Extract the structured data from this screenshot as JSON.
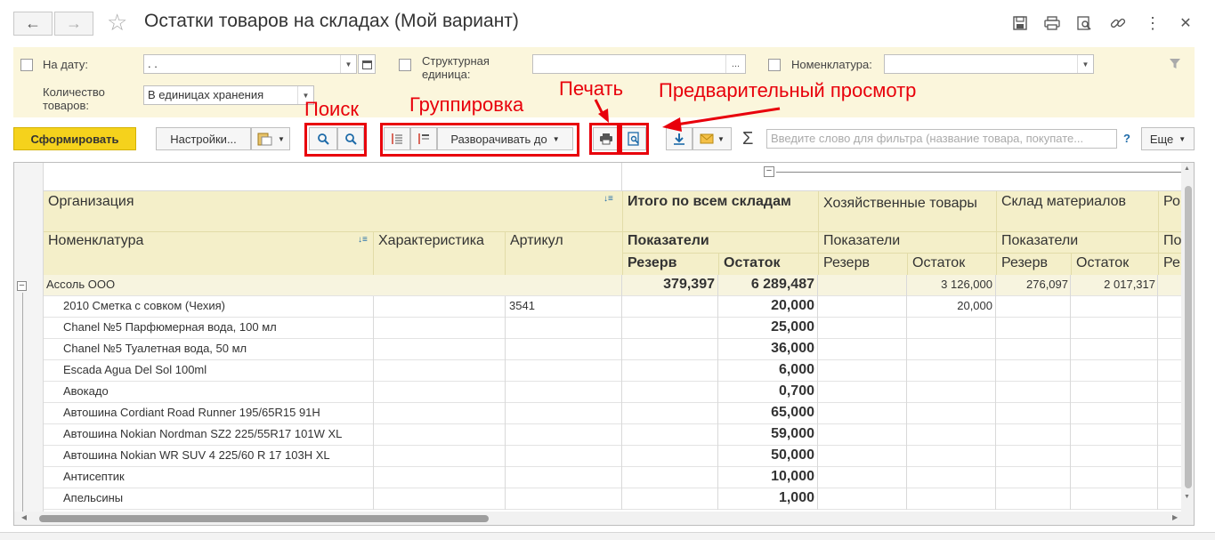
{
  "window": {
    "title": "Остатки товаров на складах (Мой вариант)",
    "back_icon": "←",
    "forward_icon": "→",
    "star_icon": "☆"
  },
  "filters": {
    "date_label": "На дату:",
    "date_value": " .  .",
    "structural_label": "Структурная единица:",
    "structural_value": "",
    "structural_button": "...",
    "nomenclature_label": "Номенклатура:",
    "nomenclature_value": "",
    "quantity_label": "Количество товаров:",
    "quantity_value": "В единицах хранения"
  },
  "toolbar": {
    "generate_label": "Сформировать",
    "settings_label": "Настройки...",
    "expand_label": "Разворачивать до",
    "filter_placeholder": "Введите слово для фильтра (название товара, покупате...",
    "help_label": "?",
    "more_label": "Еще",
    "sigma_label": "Σ"
  },
  "annotations": {
    "search": "Поиск",
    "grouping": "Группировка",
    "print": "Печать",
    "preview": "Предварительный просмотр"
  },
  "table": {
    "header": {
      "organization": "Организация",
      "nomenclature": "Номенклатура",
      "characteristic": "Характеристика",
      "article": "Артикул",
      "total": "Итого по всем складам",
      "warehouse1": "Хозяйственные товары",
      "warehouse2": "Склад материалов",
      "warehouse3": "Ро",
      "indicators": "Показатели",
      "indicators_cut": "По",
      "reserve": "Резерв",
      "remainder": "Остаток",
      "reserve_cut": "Ре"
    },
    "group_row": {
      "name": "Ассоль ООО",
      "total_reserve": "379,397",
      "total_remainder": "6 289,487",
      "w1_reserve": "",
      "w1_remainder": "3 126,000",
      "w2_reserve": "276,097",
      "w2_remainder": "2 017,317"
    },
    "rows": [
      {
        "name": "2010 Сметка с совком (Чехия)",
        "article": "3541",
        "total_remainder": "20,000",
        "w1_remainder": "20,000"
      },
      {
        "name": "Chanel №5 Парфюмерная вода, 100 мл",
        "article": "",
        "total_remainder": "25,000",
        "w1_remainder": ""
      },
      {
        "name": "Chanel №5 Туалетная вода, 50 мл",
        "article": "",
        "total_remainder": "36,000",
        "w1_remainder": ""
      },
      {
        "name": "Escada Agua Del Sol 100ml",
        "article": "",
        "total_remainder": "6,000",
        "w1_remainder": ""
      },
      {
        "name": "Авокадо",
        "article": "",
        "total_remainder": "0,700",
        "w1_remainder": ""
      },
      {
        "name": "Автошина Cordiant Road Runner 195/65R15 91H",
        "article": "",
        "total_remainder": "65,000",
        "w1_remainder": ""
      },
      {
        "name": "Автошина Nokian Nordman SZ2 225/55R17 101W XL",
        "article": "",
        "total_remainder": "59,000",
        "w1_remainder": ""
      },
      {
        "name": "Автошина Nokian WR SUV 4 225/60 R 17 103H XL",
        "article": "",
        "total_remainder": "50,000",
        "w1_remainder": ""
      },
      {
        "name": "Антисептик",
        "article": "",
        "total_remainder": "10,000",
        "w1_remainder": ""
      },
      {
        "name": "Апельсины",
        "article": "",
        "total_remainder": "1,000",
        "w1_remainder": ""
      }
    ]
  },
  "colors": {
    "accent_yellow": "#f5d21c",
    "panel_bg": "#fbf6dc",
    "header_bg": "#f4efc9",
    "annotation_red": "#e8000b"
  }
}
